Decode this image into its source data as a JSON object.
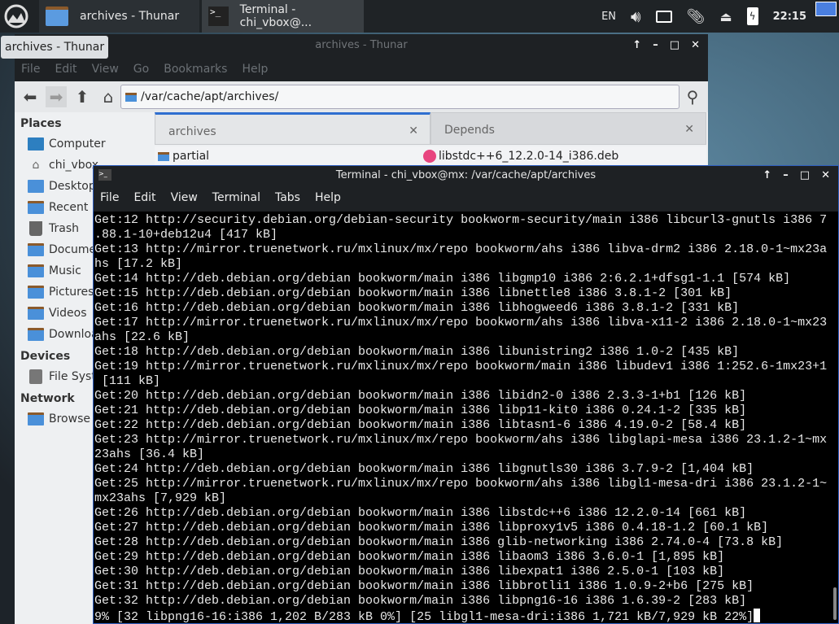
{
  "taskbar": {
    "tasks": [
      {
        "label": "archives - Thunar",
        "icon": "folder-icon"
      },
      {
        "label": "Terminal - chi_vbox@...",
        "icon": "terminal-icon"
      }
    ],
    "tray": {
      "lang": "EN",
      "clock": "22:15"
    }
  },
  "tooltip": "archives - Thunar",
  "thunar": {
    "title": "archives - Thunar",
    "menu": [
      "File",
      "Edit",
      "View",
      "Go",
      "Bookmarks",
      "Help"
    ],
    "location": "/var/cache/apt/archives/",
    "sidebar": {
      "places_header": "Places",
      "places": [
        "Computer",
        "chi_vbox",
        "Desktop",
        "Recent",
        "Trash",
        "Documents",
        "Music",
        "Pictures",
        "Videos",
        "Downloads"
      ],
      "devices_header": "Devices",
      "devices": [
        "File System"
      ],
      "network_header": "Network",
      "network": [
        "Browse Network"
      ]
    },
    "tabs": [
      "archives",
      "Depends"
    ],
    "files": [
      "partial",
      "libstdc++6_12.2.0-14_i386.deb"
    ]
  },
  "terminal": {
    "title": "Terminal - chi_vbox@mx: /var/cache/apt/archives",
    "menu": [
      "File",
      "Edit",
      "View",
      "Terminal",
      "Tabs",
      "Help"
    ],
    "lines": [
      "Get:12 http://security.debian.org/debian-security bookworm-security/main i386 libcurl3-gnutls i386 7",
      ".88.1-10+deb12u4 [417 kB]",
      "Get:13 http://mirror.truenetwork.ru/mxlinux/mx/repo bookworm/ahs i386 libva-drm2 i386 2.18.0-1~mx23a",
      "hs [17.2 kB]",
      "Get:14 http://deb.debian.org/debian bookworm/main i386 libgmp10 i386 2:6.2.1+dfsg1-1.1 [574 kB]",
      "Get:15 http://deb.debian.org/debian bookworm/main i386 libnettle8 i386 3.8.1-2 [301 kB]",
      "Get:16 http://deb.debian.org/debian bookworm/main i386 libhogweed6 i386 3.8.1-2 [331 kB]",
      "Get:17 http://mirror.truenetwork.ru/mxlinux/mx/repo bookworm/ahs i386 libva-x11-2 i386 2.18.0-1~mx23",
      "ahs [22.6 kB]",
      "Get:18 http://deb.debian.org/debian bookworm/main i386 libunistring2 i386 1.0-2 [435 kB]",
      "Get:19 http://mirror.truenetwork.ru/mxlinux/mx/repo bookworm/main i386 libudev1 i386 1:252.6-1mx23+1",
      " [111 kB]",
      "Get:20 http://deb.debian.org/debian bookworm/main i386 libidn2-0 i386 2.3.3-1+b1 [126 kB]",
      "Get:21 http://deb.debian.org/debian bookworm/main i386 libp11-kit0 i386 0.24.1-2 [335 kB]",
      "Get:22 http://deb.debian.org/debian bookworm/main i386 libtasn1-6 i386 4.19.0-2 [58.4 kB]",
      "Get:23 http://mirror.truenetwork.ru/mxlinux/mx/repo bookworm/ahs i386 libglapi-mesa i386 23.1.2-1~mx",
      "23ahs [36.4 kB]",
      "Get:24 http://deb.debian.org/debian bookworm/main i386 libgnutls30 i386 3.7.9-2 [1,404 kB]",
      "Get:25 http://mirror.truenetwork.ru/mxlinux/mx/repo bookworm/ahs i386 libgl1-mesa-dri i386 23.1.2-1~",
      "mx23ahs [7,929 kB]",
      "Get:26 http://deb.debian.org/debian bookworm/main i386 libstdc++6 i386 12.2.0-14 [661 kB]",
      "Get:27 http://deb.debian.org/debian bookworm/main i386 libproxy1v5 i386 0.4.18-1.2 [60.1 kB]",
      "Get:28 http://deb.debian.org/debian bookworm/main i386 glib-networking i386 2.74.0-4 [73.8 kB]",
      "Get:29 http://deb.debian.org/debian bookworm/main i386 libaom3 i386 3.6.0-1 [1,895 kB]",
      "Get:30 http://deb.debian.org/debian bookworm/main i386 libexpat1 i386 2.5.0-1 [103 kB]",
      "Get:31 http://deb.debian.org/debian bookworm/main i386 libbrotli1 i386 1.0.9-2+b6 [275 kB]",
      "Get:32 http://deb.debian.org/debian bookworm/main i386 libpng16-16 i386 1.6.39-2 [283 kB]"
    ],
    "progress_line": "9% [32 libpng16-16:i386 1,202 B/283 kB 0%] [25 libgl1-mesa-dri:i386 1,721 kB/7,929 kB 22%]"
  }
}
